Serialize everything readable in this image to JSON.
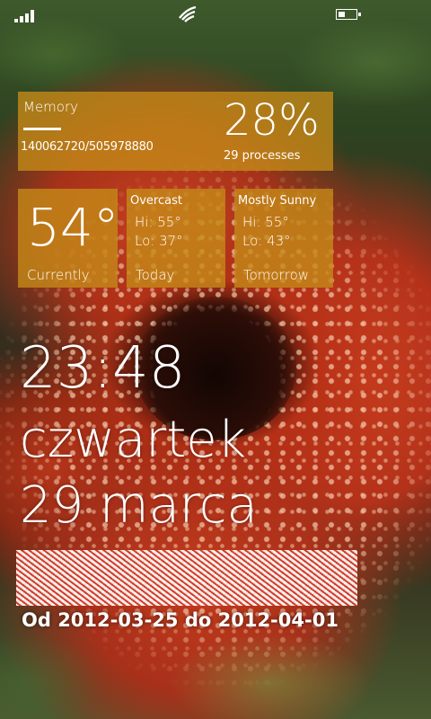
{
  "status_bar": {
    "signal_icon": "signal-bars-icon",
    "wifi_icon": "wifi-icon",
    "battery_icon": "battery-icon",
    "battery_level": 0.4
  },
  "memory_tile": {
    "title": "Memory",
    "detail": "140062720/505978880",
    "percent": "28%",
    "processes": "29 processes"
  },
  "weather": {
    "current": {
      "temp": "54°",
      "label": "Currently"
    },
    "today": {
      "condition": "Overcast",
      "hi": "Hi: 55°",
      "lo": "Lo: 37°",
      "label": "Today"
    },
    "tomorrow": {
      "condition": "Mostly Sunny",
      "hi": "Hi: 55°",
      "lo": "Lo: 43°",
      "label": "Tomorrow"
    }
  },
  "lock": {
    "time": "23:48",
    "day": "czwartek",
    "date": "29 marca",
    "range": "Od 2012-03-25 do 2012-04-01"
  },
  "colors": {
    "tile": "#c48a18"
  }
}
